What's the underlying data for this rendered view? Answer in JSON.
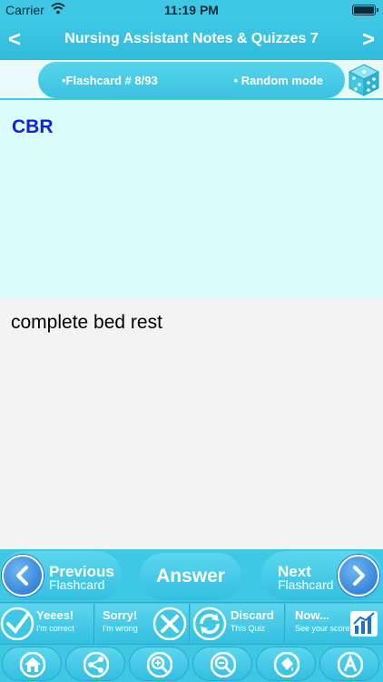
{
  "status_bar": {
    "carrier": "Carrier",
    "time": "11:19 PM"
  },
  "header": {
    "title": "Nursing Assistant Notes & Quizzes 7",
    "prev_label": "<",
    "next_label": ">"
  },
  "flashcard_bar": {
    "counter": "•Flashcard #  8/93",
    "mode": "• Random mode"
  },
  "card": {
    "question": "CBR",
    "answer": "complete bed rest"
  },
  "controls": {
    "previous_big": "Previous",
    "previous_small": "Flashcard",
    "answer": "Answer",
    "next_big": "Next",
    "next_small": "Flashcard"
  },
  "actions": {
    "yes_big": "Yeees!",
    "yes_small": "I'm correct",
    "sorry_big": "Sorry!",
    "sorry_small": "I'm wrong",
    "discard_big": "Discard",
    "discard_small": "This Quiz",
    "score_big": "Now...",
    "score_small": "See your score"
  },
  "toolbar": {
    "icons": [
      "home-icon",
      "share-icon",
      "zoom-in-icon",
      "zoom-out-icon",
      "paint-bucket-icon",
      "font-icon"
    ]
  },
  "colors": {
    "accent": "#3fc8e4",
    "question_bg": "#d9fdfd",
    "question_text": "#1522d0",
    "answer_bg": "#f3f3f3",
    "nav_button": "#1f6fd0"
  }
}
